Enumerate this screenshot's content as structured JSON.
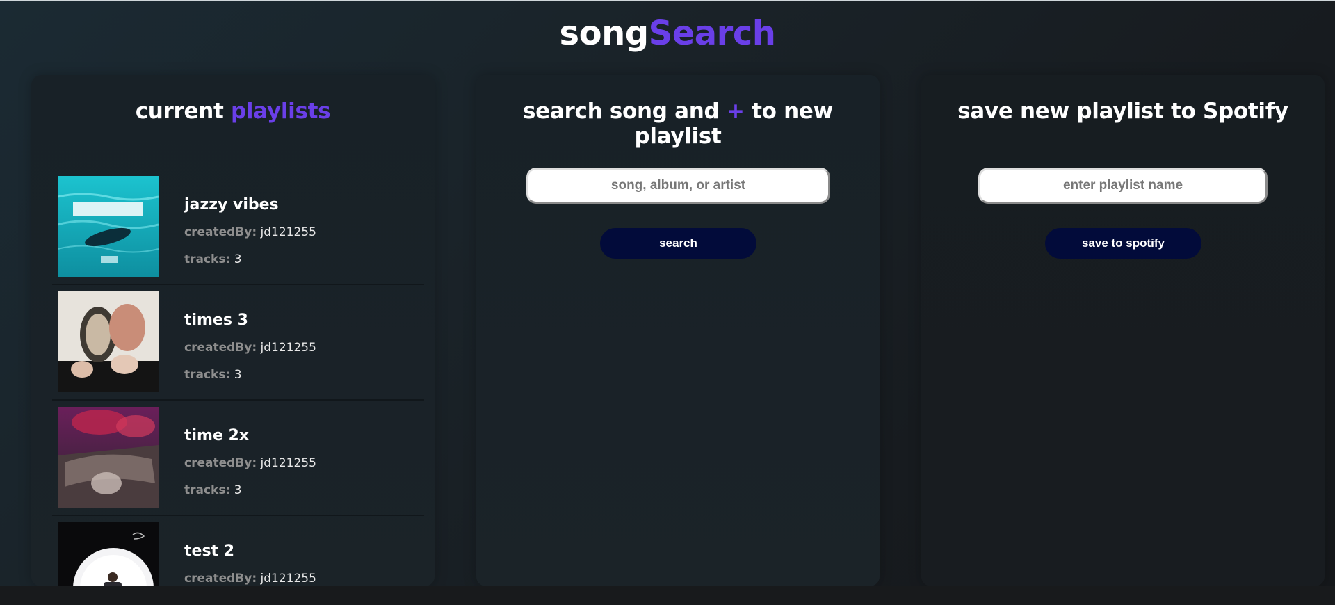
{
  "app": {
    "title_part1": "song",
    "title_part2": "Search"
  },
  "playlists_panel": {
    "title_part1": "current ",
    "title_part2": "playlists",
    "created_label": "createdBy:",
    "tracks_label": "tracks:",
    "items": [
      {
        "name": "jazzy vibes",
        "created_by": "jd121255",
        "tracks": "3",
        "cover_icon": "album-cover-the-water"
      },
      {
        "name": "times 3",
        "created_by": "jd121255",
        "tracks": "3",
        "cover_icon": "album-cover-hands"
      },
      {
        "name": "time 2x",
        "created_by": "jd121255",
        "tracks": "3",
        "cover_icon": "album-cover-car"
      },
      {
        "name": "test 2",
        "created_by": "jd121255",
        "tracks": "",
        "cover_icon": "album-cover-spotlight"
      }
    ]
  },
  "search_panel": {
    "title_part1": "search song and ",
    "title_plus": "+",
    "title_part2": " to new playlist",
    "input_placeholder": "song, album, or artist",
    "button_label": "search"
  },
  "save_panel": {
    "title": "save new playlist to Spotify",
    "input_placeholder": "enter playlist name",
    "button_label": "save to spotify"
  },
  "colors": {
    "accent": "#6a3fe8",
    "button_bg": "#020b3a"
  }
}
